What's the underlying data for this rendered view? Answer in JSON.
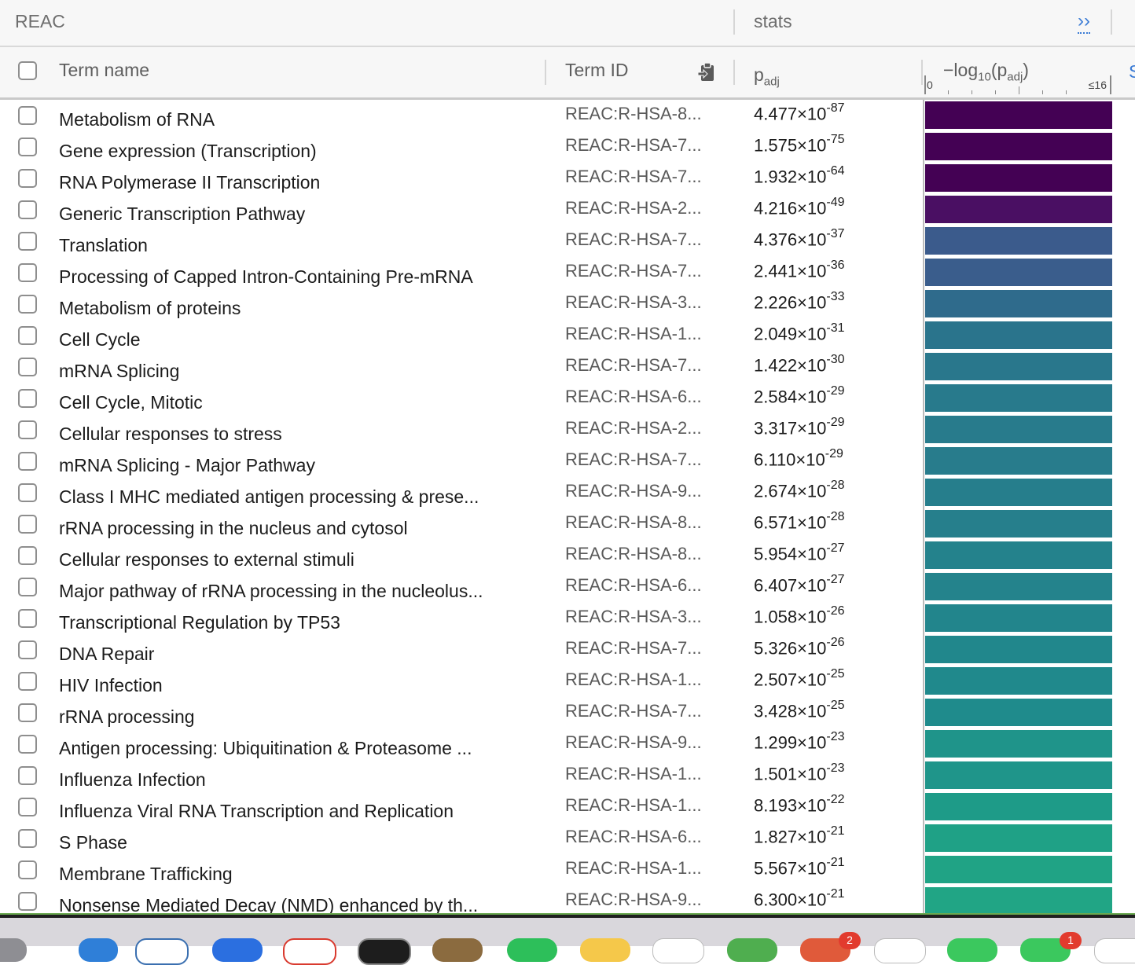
{
  "group": {
    "source": "REAC",
    "stats": "stats",
    "expand": "››"
  },
  "header": {
    "term_name": "Term name",
    "term_id": "Term ID",
    "padj_base": "p",
    "padj_sub": "adj",
    "neglog_prefix": "−log",
    "neglog_sub10": "10",
    "neglog_open": "(p",
    "neglog_sub_adj": "adj",
    "neglog_close": ")",
    "axis_min": "0",
    "axis_max": "≤16",
    "edge_text": "S"
  },
  "rows": [
    {
      "name": "Metabolism of RNA",
      "id": "REAC:R-HSA-8...",
      "mant": "4.477×10",
      "exp": "-87",
      "color": "#440154"
    },
    {
      "name": "Gene expression (Transcription)",
      "id": "REAC:R-HSA-7...",
      "mant": "1.575×10",
      "exp": "-75",
      "color": "#440154"
    },
    {
      "name": "RNA Polymerase II Transcription",
      "id": "REAC:R-HSA-7...",
      "mant": "1.932×10",
      "exp": "-64",
      "color": "#440154"
    },
    {
      "name": "Generic Transcription Pathway",
      "id": "REAC:R-HSA-2...",
      "mant": "4.216×10",
      "exp": "-49",
      "color": "#4a0f63"
    },
    {
      "name": "Translation",
      "id": "REAC:R-HSA-7...",
      "mant": "4.376×10",
      "exp": "-37",
      "color": "#3b5b8c"
    },
    {
      "name": "Processing of Capped Intron-Containing Pre-mRNA",
      "id": "REAC:R-HSA-7...",
      "mant": "2.441×10",
      "exp": "-36",
      "color": "#3a5d8c"
    },
    {
      "name": "Metabolism of proteins",
      "id": "REAC:R-HSA-3...",
      "mant": "2.226×10",
      "exp": "-33",
      "color": "#2f6b8c"
    },
    {
      "name": "Cell Cycle",
      "id": "REAC:R-HSA-1...",
      "mant": "2.049×10",
      "exp": "-31",
      "color": "#2a748c"
    },
    {
      "name": "mRNA Splicing",
      "id": "REAC:R-HSA-7...",
      "mant": "1.422×10",
      "exp": "-30",
      "color": "#29778c"
    },
    {
      "name": "Cell Cycle, Mitotic",
      "id": "REAC:R-HSA-6...",
      "mant": "2.584×10",
      "exp": "-29",
      "color": "#287a8c"
    },
    {
      "name": "Cellular responses to stress",
      "id": "REAC:R-HSA-2...",
      "mant": "3.317×10",
      "exp": "-29",
      "color": "#287b8c"
    },
    {
      "name": "mRNA Splicing - Major Pathway",
      "id": "REAC:R-HSA-7...",
      "mant": "6.110×10",
      "exp": "-29",
      "color": "#287c8c"
    },
    {
      "name": "Class I MHC mediated antigen processing & prese...",
      "id": "REAC:R-HSA-9...",
      "mant": "2.674×10",
      "exp": "-28",
      "color": "#267e8c"
    },
    {
      "name": "rRNA processing in the nucleus and cytosol",
      "id": "REAC:R-HSA-8...",
      "mant": "6.571×10",
      "exp": "-28",
      "color": "#267f8c"
    },
    {
      "name": "Cellular responses to external stimuli",
      "id": "REAC:R-HSA-8...",
      "mant": "5.954×10",
      "exp": "-27",
      "color": "#24828c"
    },
    {
      "name": "Major pathway of rRNA processing in the nucleolus...",
      "id": "REAC:R-HSA-6...",
      "mant": "6.407×10",
      "exp": "-27",
      "color": "#24838c"
    },
    {
      "name": "Transcriptional Regulation by TP53",
      "id": "REAC:R-HSA-3...",
      "mant": "1.058×10",
      "exp": "-26",
      "color": "#22858c"
    },
    {
      "name": "DNA Repair",
      "id": "REAC:R-HSA-7...",
      "mant": "5.326×10",
      "exp": "-26",
      "color": "#21878c"
    },
    {
      "name": "HIV Infection",
      "id": "REAC:R-HSA-1...",
      "mant": "2.507×10",
      "exp": "-25",
      "color": "#20898c"
    },
    {
      "name": "rRNA processing",
      "id": "REAC:R-HSA-7...",
      "mant": "3.428×10",
      "exp": "-25",
      "color": "#1f8b8c"
    },
    {
      "name": "Antigen processing: Ubiquitination & Proteasome ...",
      "id": "REAC:R-HSA-9...",
      "mant": "1.299×10",
      "exp": "-23",
      "color": "#1f948a"
    },
    {
      "name": "Influenza Infection",
      "id": "REAC:R-HSA-1...",
      "mant": "1.501×10",
      "exp": "-23",
      "color": "#1f958a"
    },
    {
      "name": "Influenza Viral RNA Transcription and Replication",
      "id": "REAC:R-HSA-1...",
      "mant": "8.193×10",
      "exp": "-22",
      "color": "#1e9b88"
    },
    {
      "name": "S Phase",
      "id": "REAC:R-HSA-6...",
      "mant": "1.827×10",
      "exp": "-21",
      "color": "#1fa186"
    },
    {
      "name": "Membrane Trafficking",
      "id": "REAC:R-HSA-1...",
      "mant": "5.567×10",
      "exp": "-21",
      "color": "#20a385"
    },
    {
      "name": "Nonsense Mediated Decay (NMD) enhanced by th...",
      "id": "REAC:R-HSA-9...",
      "mant": "6.300×10",
      "exp": "-21",
      "color": "#21a585"
    }
  ],
  "dock": {
    "badge_a": "2",
    "badge_b": "1"
  }
}
